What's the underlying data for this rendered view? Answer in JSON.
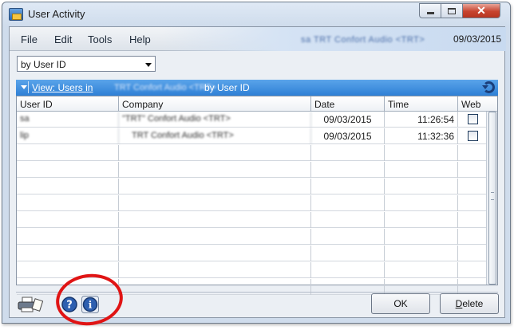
{
  "window": {
    "title": "User Activity",
    "close_glyph": "✕"
  },
  "menu": {
    "items": [
      "File",
      "Edit",
      "Tools",
      "Help"
    ],
    "company": "sa TRT Confort Audio <TRT>",
    "date": "09/03/2015"
  },
  "filter": {
    "selected": "by User ID"
  },
  "view": {
    "label": "View: Users in",
    "company": "TRT Confort Audio <TRT>",
    "suffix": "by User ID"
  },
  "grid": {
    "columns": [
      "User ID",
      "Company",
      "Date",
      "Time",
      "Web"
    ],
    "rows": [
      {
        "user": "sa",
        "company": "\"TRT\" Confort Audio <TRT>",
        "date": "09/03/2015",
        "time": "11:26:54",
        "web": false
      },
      {
        "user": "lip",
        "company": "TRT Confort Audio <TRT>",
        "date": "09/03/2015",
        "time": "11:32:36",
        "web": false
      }
    ],
    "empty_rows": 9
  },
  "footer": {
    "ok_label": "OK",
    "delete_label": "Delete",
    "delete_hotkey": "D",
    "delete_rest": "elete"
  },
  "icons": {
    "window_icon": "app-window-icon",
    "printer": "printer-icon",
    "help": "help-icon",
    "info": "info-icon",
    "refresh": "refresh-icon"
  },
  "colors": {
    "viewbar": "#2f80d6",
    "annotation": "#e01414"
  }
}
